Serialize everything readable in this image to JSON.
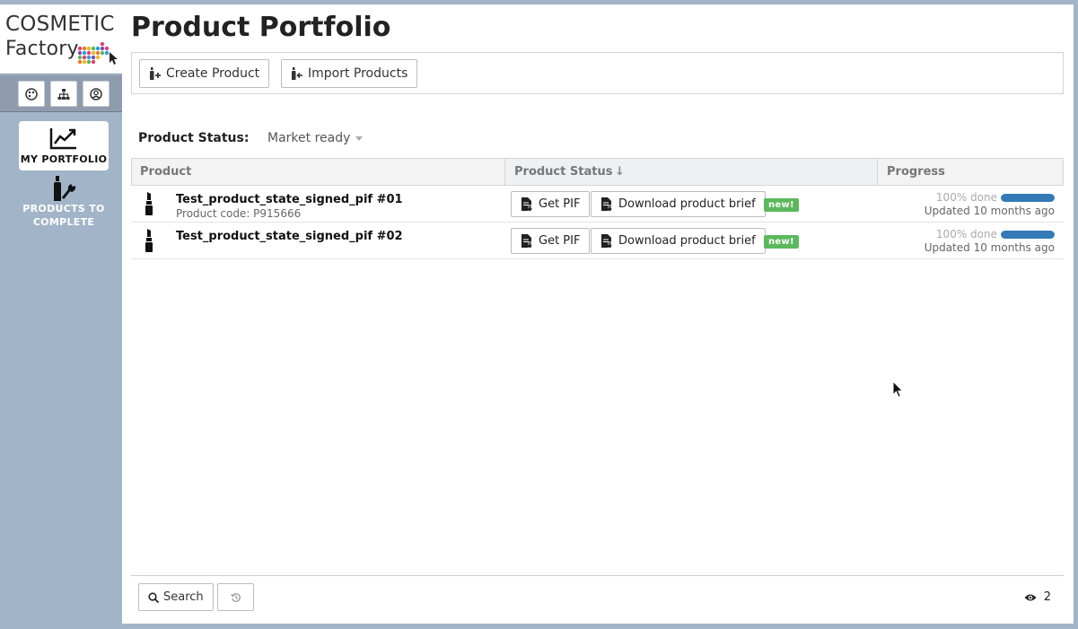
{
  "sidebar": {
    "logo_line1": "COSMETIC",
    "logo_line2": "Factory",
    "nav": [
      {
        "label": "MY PORTFOLIO",
        "icon": "chart-line-icon",
        "active": true
      },
      {
        "label": "PRODUCTS TO COMPLETE",
        "icon": "bottle-wrench-icon",
        "active": false
      }
    ],
    "icon_buttons": [
      "palette-icon",
      "sitemap-icon",
      "user-circle-icon"
    ]
  },
  "header": {
    "title": "Product Portfolio"
  },
  "toolbar": {
    "create_label": "Create Product",
    "import_label": "Import Products"
  },
  "filter": {
    "label": "Product Status:",
    "selected": "Market ready"
  },
  "table": {
    "columns": [
      "Product",
      "Product Status",
      "Progress"
    ],
    "sort_indicator": "↓",
    "rows": [
      {
        "name": "Test_product_state_signed_pif #01",
        "code": "Product code: P915666",
        "get_pif": "Get PIF",
        "download_brief": "Download product brief",
        "badge": "new!",
        "progress": 1.0,
        "progress_text": "100% done",
        "updated": "Updated 10 months ago"
      },
      {
        "name": "Test_product_state_signed_pif #02",
        "code": "",
        "get_pif": "Get PIF",
        "download_brief": "Download product brief",
        "badge": "new!",
        "progress": 1.0,
        "progress_text": "100% done",
        "updated": "Updated 10 months ago"
      }
    ]
  },
  "footer": {
    "search_label": "Search",
    "view_count": "2"
  },
  "colors": {
    "sidebar_bg": "#a2b4c8",
    "accent_blue": "#337ab7",
    "badge_green": "#5cb85c"
  }
}
